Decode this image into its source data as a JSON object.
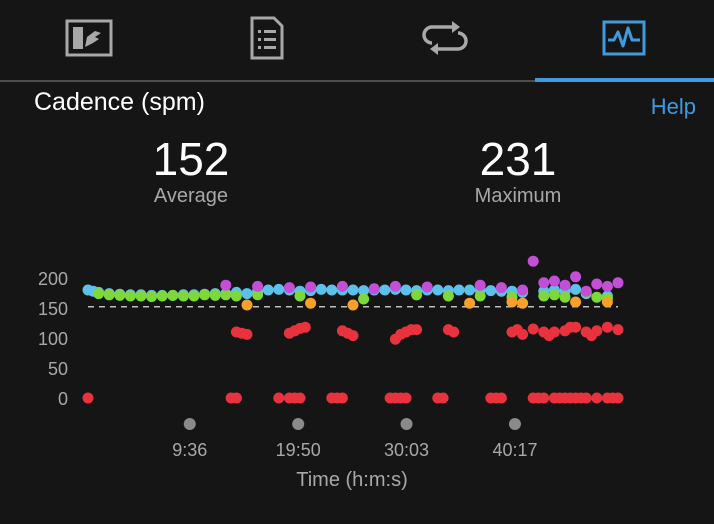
{
  "tabs": [
    {
      "name": "tab-overview",
      "icon": "chart-card-icon",
      "active": false
    },
    {
      "name": "tab-details",
      "icon": "document-list-icon",
      "active": false
    },
    {
      "name": "tab-laps",
      "icon": "loop-arrows-icon",
      "active": false
    },
    {
      "name": "tab-charts",
      "icon": "waveform-icon",
      "active": true
    }
  ],
  "header": {
    "title": "Cadence (spm)",
    "help_label": "Help"
  },
  "stats": {
    "average_value": "152",
    "average_label": "Average",
    "maximum_value": "231",
    "maximum_label": "Maximum"
  },
  "colors": {
    "accent": "#3d9be0",
    "background": "#151515",
    "zone_red": "#e8323e",
    "zone_orange": "#f5a12c",
    "zone_green": "#7ed83a",
    "zone_blue": "#5cc1ea",
    "zone_purple": "#c24fd6"
  },
  "chart_data": {
    "type": "scatter",
    "title": "",
    "xlabel": "Time (h:m:s)",
    "ylabel": "",
    "x_unit": "minutes",
    "xlim": [
      0,
      50
    ],
    "ylim": [
      0,
      200
    ],
    "yticks": [
      0,
      50,
      100,
      150,
      200
    ],
    "xtick_labels": [
      "9:36",
      "19:50",
      "30:03",
      "40:17"
    ],
    "xtick_values": [
      9.6,
      19.83,
      30.05,
      40.28
    ],
    "average_line": 152,
    "grid": false,
    "series": [
      {
        "color": "#5cc1ea",
        "points": [
          [
            0,
            180
          ],
          [
            0.5,
            178
          ],
          [
            1,
            176
          ],
          [
            2,
            174
          ],
          [
            3,
            173
          ],
          [
            4,
            172
          ],
          [
            5,
            172
          ],
          [
            6,
            171
          ],
          [
            7,
            171
          ],
          [
            8,
            171
          ],
          [
            9,
            172
          ],
          [
            10,
            172
          ],
          [
            11,
            173
          ],
          [
            12,
            174
          ],
          [
            13,
            174
          ],
          [
            14,
            176
          ],
          [
            15,
            174
          ],
          [
            16,
            178
          ],
          [
            17,
            180
          ],
          [
            18,
            181
          ],
          [
            19,
            180
          ],
          [
            20,
            178
          ],
          [
            21,
            179
          ],
          [
            22,
            181
          ],
          [
            23,
            180
          ],
          [
            24,
            180
          ],
          [
            25,
            180
          ],
          [
            26,
            179
          ],
          [
            27,
            180
          ],
          [
            28,
            180
          ],
          [
            29,
            181
          ],
          [
            30,
            180
          ],
          [
            31,
            179
          ],
          [
            32,
            180
          ],
          [
            33,
            180
          ],
          [
            34,
            179
          ],
          [
            35,
            180
          ],
          [
            36,
            180
          ],
          [
            37,
            180
          ],
          [
            38,
            179
          ],
          [
            39,
            178
          ],
          [
            40,
            178
          ],
          [
            41,
            176
          ],
          [
            43,
            178
          ],
          [
            44,
            180
          ],
          [
            45,
            178
          ],
          [
            46,
            181
          ],
          [
            47,
            174
          ],
          [
            49,
            170
          ]
        ]
      },
      {
        "color": "#7ed83a",
        "points": [
          [
            1,
            174
          ],
          [
            2,
            172
          ],
          [
            3,
            171
          ],
          [
            4,
            170
          ],
          [
            5,
            170
          ],
          [
            6,
            169
          ],
          [
            7,
            170
          ],
          [
            8,
            171
          ],
          [
            9,
            170
          ],
          [
            10,
            170
          ],
          [
            11,
            172
          ],
          [
            12,
            171
          ],
          [
            13,
            172
          ],
          [
            14,
            170
          ],
          [
            16,
            172
          ],
          [
            20,
            170
          ],
          [
            26,
            165
          ],
          [
            31,
            172
          ],
          [
            34,
            170
          ],
          [
            37,
            170
          ],
          [
            40,
            168
          ],
          [
            43,
            170
          ],
          [
            44,
            172
          ],
          [
            45,
            168
          ],
          [
            47,
            176
          ],
          [
            48,
            168
          ],
          [
            49,
            166
          ]
        ]
      },
      {
        "color": "#f5a12c",
        "points": [
          [
            15,
            155
          ],
          [
            21,
            158
          ],
          [
            25,
            155
          ],
          [
            36,
            158
          ],
          [
            40,
            160
          ],
          [
            41,
            158
          ],
          [
            46,
            160
          ],
          [
            49,
            160
          ]
        ]
      },
      {
        "color": "#c24fd6",
        "points": [
          [
            13,
            188
          ],
          [
            16,
            186
          ],
          [
            19,
            184
          ],
          [
            21,
            185
          ],
          [
            24,
            186
          ],
          [
            27,
            182
          ],
          [
            29,
            186
          ],
          [
            32,
            185
          ],
          [
            37,
            188
          ],
          [
            39,
            184
          ],
          [
            41,
            180
          ],
          [
            42,
            228
          ],
          [
            43,
            192
          ],
          [
            44,
            195
          ],
          [
            45,
            188
          ],
          [
            46,
            202
          ],
          [
            47,
            178
          ],
          [
            48,
            190
          ],
          [
            49,
            186
          ],
          [
            50,
            192
          ]
        ]
      },
      {
        "color": "#e8323e",
        "points": [
          [
            0,
            0
          ],
          [
            13.5,
            0
          ],
          [
            14,
            0
          ],
          [
            18,
            0
          ],
          [
            19,
            0
          ],
          [
            19.5,
            0
          ],
          [
            20,
            0
          ],
          [
            23,
            0
          ],
          [
            23.5,
            0
          ],
          [
            24,
            0
          ],
          [
            28.5,
            0
          ],
          [
            29,
            0
          ],
          [
            29.5,
            0
          ],
          [
            30,
            0
          ],
          [
            33,
            0
          ],
          [
            33.5,
            0
          ],
          [
            38,
            0
          ],
          [
            38.5,
            0
          ],
          [
            39,
            0
          ],
          [
            42,
            0
          ],
          [
            42.5,
            0
          ],
          [
            43,
            0
          ],
          [
            44,
            0
          ],
          [
            44.5,
            0
          ],
          [
            45,
            0
          ],
          [
            45.5,
            0
          ],
          [
            46,
            0
          ],
          [
            46.5,
            0
          ],
          [
            47,
            0
          ],
          [
            48,
            0
          ],
          [
            49,
            0
          ],
          [
            49.5,
            0
          ],
          [
            50,
            0
          ],
          [
            14,
            110
          ],
          [
            14.5,
            108
          ],
          [
            15,
            106
          ],
          [
            19,
            108
          ],
          [
            19.5,
            112
          ],
          [
            20,
            116
          ],
          [
            20.5,
            118
          ],
          [
            24,
            112
          ],
          [
            24.5,
            108
          ],
          [
            25,
            104
          ],
          [
            29,
            98
          ],
          [
            29.5,
            106
          ],
          [
            30,
            110
          ],
          [
            30.5,
            114
          ],
          [
            31,
            114
          ],
          [
            34,
            114
          ],
          [
            34.5,
            110
          ],
          [
            40,
            110
          ],
          [
            40.5,
            114
          ],
          [
            41,
            106
          ],
          [
            42,
            115
          ],
          [
            43,
            110
          ],
          [
            43.5,
            104
          ],
          [
            44,
            110
          ],
          [
            45,
            112
          ],
          [
            45.5,
            118
          ],
          [
            46,
            118
          ],
          [
            47,
            110
          ],
          [
            47.5,
            104
          ],
          [
            48,
            112
          ],
          [
            49,
            118
          ],
          [
            50,
            114
          ]
        ]
      }
    ]
  }
}
